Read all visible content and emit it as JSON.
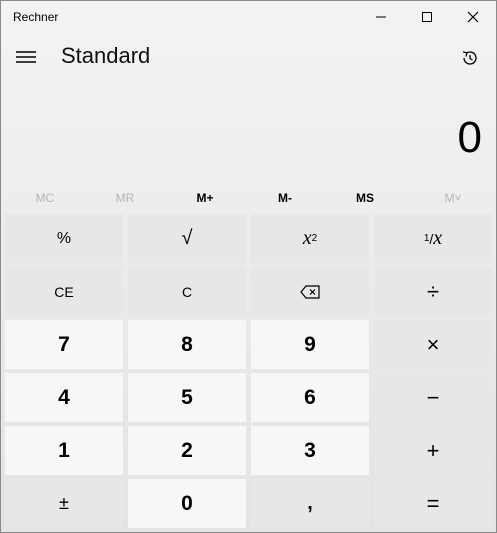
{
  "window": {
    "title": "Rechner"
  },
  "header": {
    "mode": "Standard"
  },
  "display": {
    "value": "0"
  },
  "memory": [
    "MC",
    "MR",
    "M+",
    "M-",
    "MS",
    "M˅"
  ],
  "keys": {
    "percent": "%",
    "sqrt": "√",
    "square_base": "x",
    "square_exp": "2",
    "reciprocal_num": "1",
    "reciprocal_den": "x",
    "ce": "CE",
    "c": "C",
    "divide": "÷",
    "seven": "7",
    "eight": "8",
    "nine": "9",
    "multiply": "×",
    "four": "4",
    "five": "5",
    "six": "6",
    "minus": "−",
    "one": "1",
    "two": "2",
    "three": "3",
    "plus": "+",
    "negate": "±",
    "zero": "0",
    "decimal": ",",
    "equals": "="
  }
}
